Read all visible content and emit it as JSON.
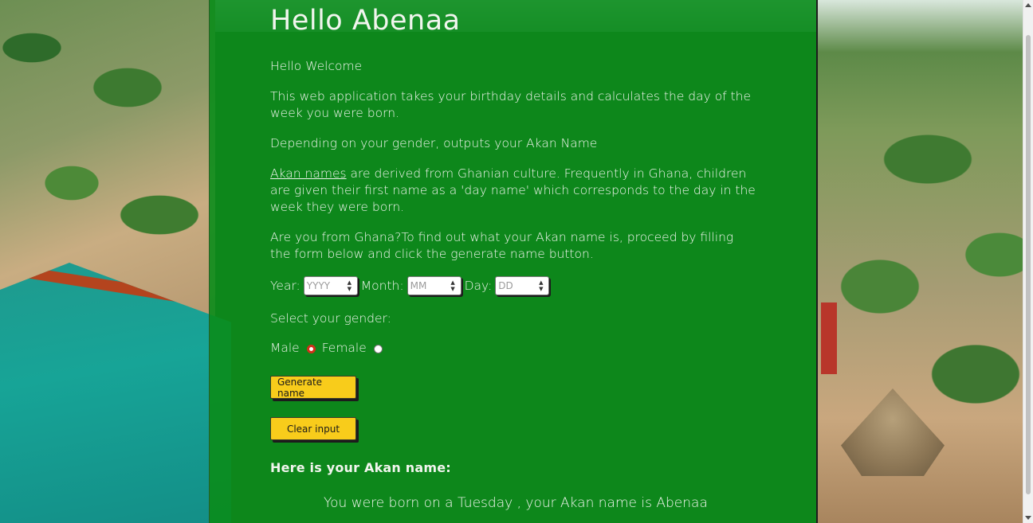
{
  "page": {
    "title": "Hello Abenaa",
    "intro": "Hello Welcome",
    "description": "This web application takes your birthday details and calculates the day of the week you were born.",
    "gender_note": "Depending on your gender, outputs your Akan Name",
    "akan_link": "Akan names",
    "akan_text": " are derived from Ghanian culture. Frequently in Ghana, children are given their first name as a 'day name' which corresponds to the day in the week they were born.",
    "instructions": "Are you from Ghana?To find out what your Akan name is, proceed by filling the form below and click the generate name button."
  },
  "form": {
    "year_label": "Year:",
    "year_placeholder": "YYYY",
    "month_label": "Month:",
    "month_placeholder": "MM",
    "day_label": "Day:",
    "day_placeholder": "DD",
    "gender_label": "Select your gender:",
    "male_label": "Male",
    "female_label": "Female",
    "selected_gender": "Male",
    "generate_button": "Generate name",
    "clear_button": "Clear input"
  },
  "result": {
    "heading": "Here is your Akan name:",
    "text": "You were born on a Tuesday , your Akan name is Abenaa"
  },
  "colors": {
    "panel_green": "#0a8c19",
    "button_yellow": "#f8cc1b",
    "radio_checked": "#d0301a"
  }
}
